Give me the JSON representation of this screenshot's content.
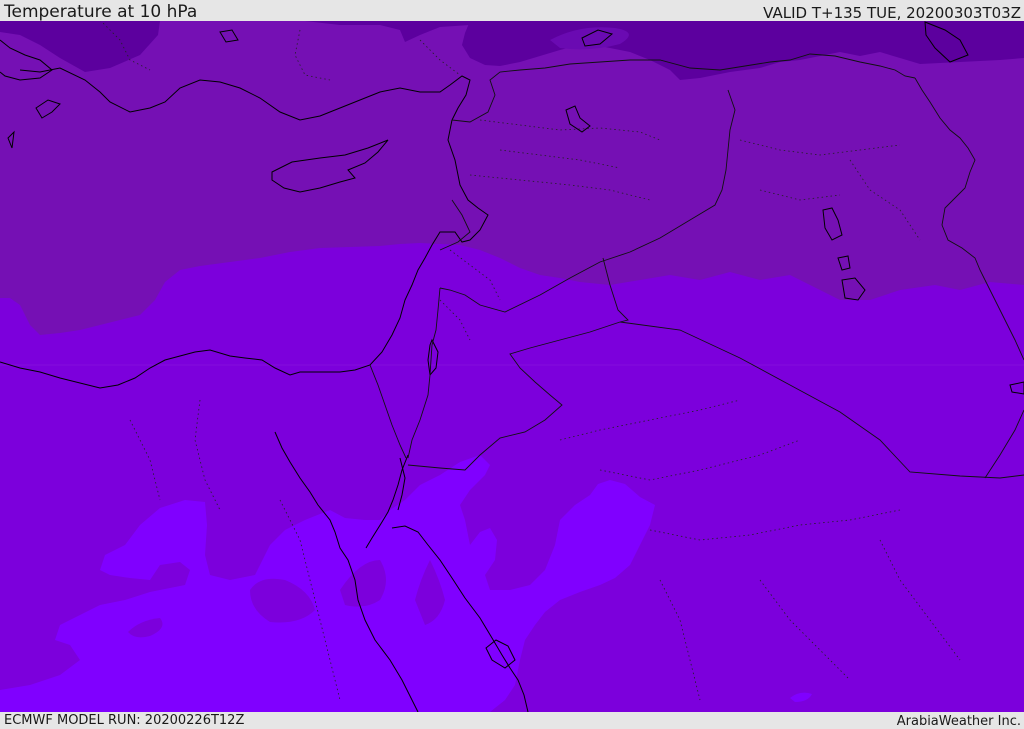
{
  "header": {
    "title": "Temperature at 10 hPa",
    "valid": "VALID T+135 TUE, 20200303T03Z"
  },
  "footer": {
    "model_run": "ECMWF MODEL RUN: 20200226T12Z",
    "credit": "ArabiaWeather Inc."
  },
  "colors": {
    "band_coldest": "#5c009e",
    "band_cold": "#7510b4",
    "band_mid": "#7c00dc",
    "band_warm": "#8000ff",
    "coastline": "#000000"
  }
}
